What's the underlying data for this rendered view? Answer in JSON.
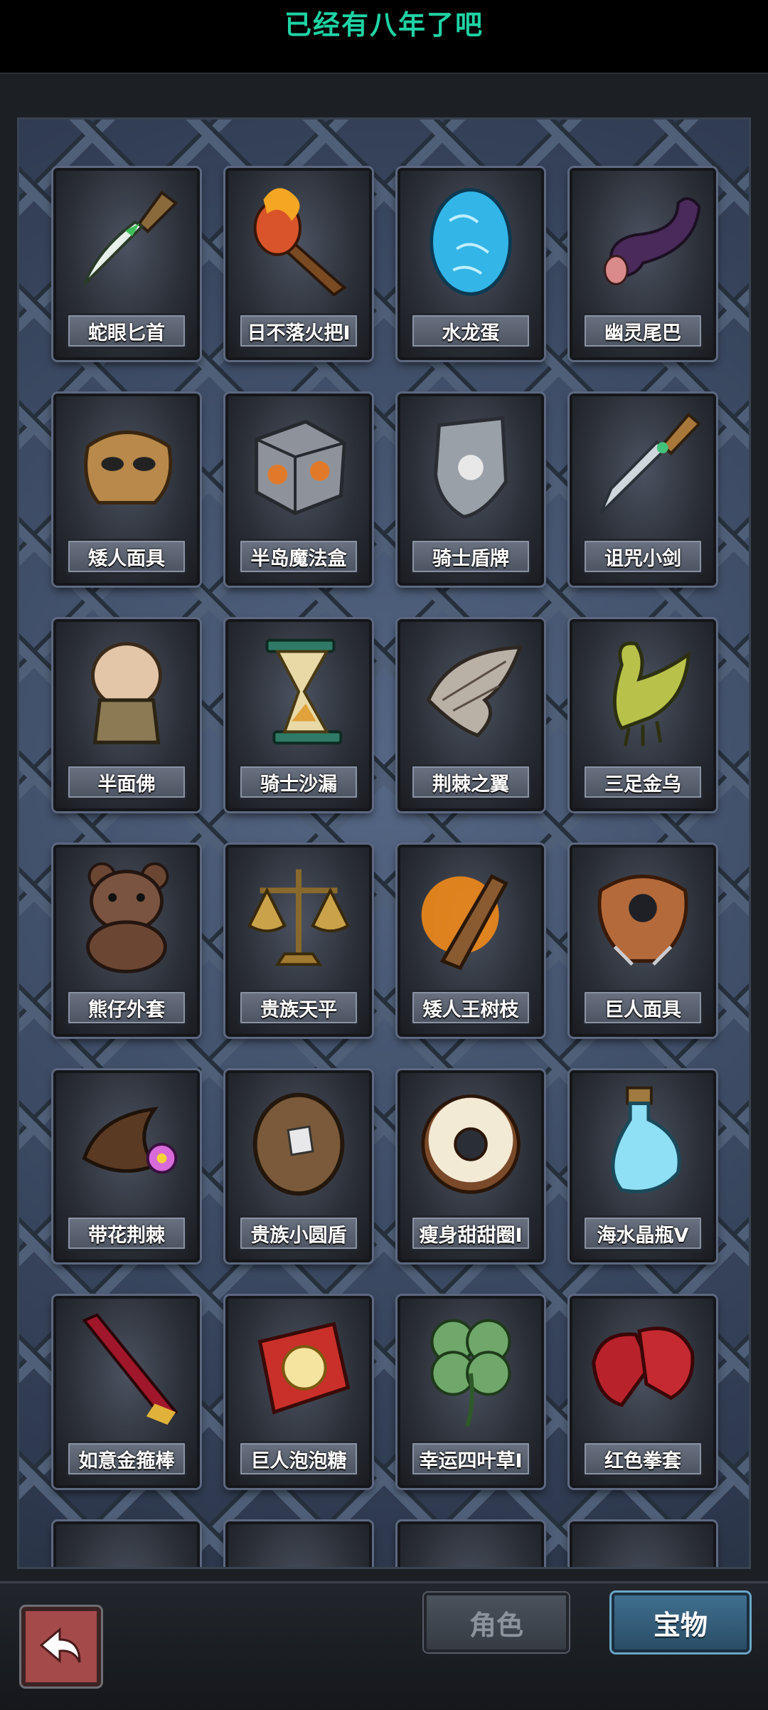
{
  "header": {
    "title": "已经有八年了吧"
  },
  "items": [
    {
      "label": "蛇眼匕首",
      "icon": "dagger-icon"
    },
    {
      "label": "日不落火把I",
      "icon": "torch-icon"
    },
    {
      "label": "水龙蛋",
      "icon": "egg-icon"
    },
    {
      "label": "幽灵尾巴",
      "icon": "ghost-tail-icon"
    },
    {
      "label": "矮人面具",
      "icon": "mask-icon"
    },
    {
      "label": "半岛魔法盒",
      "icon": "magic-box-icon"
    },
    {
      "label": "骑士盾牌",
      "icon": "shield-icon"
    },
    {
      "label": "诅咒小剑",
      "icon": "small-sword-icon"
    },
    {
      "label": "半面佛",
      "icon": "buddha-bust-icon"
    },
    {
      "label": "骑士沙漏",
      "icon": "hourglass-icon"
    },
    {
      "label": "荆棘之翼",
      "icon": "wing-icon"
    },
    {
      "label": "三足金乌",
      "icon": "golden-bird-icon"
    },
    {
      "label": "熊仔外套",
      "icon": "teddy-bear-icon"
    },
    {
      "label": "贵族天平",
      "icon": "scale-icon"
    },
    {
      "label": "矮人王树枝",
      "icon": "branch-icon"
    },
    {
      "label": "巨人面具",
      "icon": "giant-mask-icon"
    },
    {
      "label": "带花荆棘",
      "icon": "thorn-flower-icon"
    },
    {
      "label": "贵族小圆盾",
      "icon": "round-shield-icon"
    },
    {
      "label": "瘦身甜甜圈I",
      "icon": "donut-icon"
    },
    {
      "label": "海水晶瓶V",
      "icon": "potion-bottle-icon"
    },
    {
      "label": "如意金箍棒",
      "icon": "staff-icon"
    },
    {
      "label": "巨人泡泡糖",
      "icon": "gum-pack-icon"
    },
    {
      "label": "幸运四叶草I",
      "icon": "clover-icon"
    },
    {
      "label": "红色拳套",
      "icon": "boxing-glove-icon"
    }
  ],
  "bottom_bar": {
    "back_icon": "back-arrow-icon",
    "tabs": [
      {
        "label": "角色",
        "state": "inactive"
      },
      {
        "label": "宝物",
        "state": "active"
      }
    ]
  },
  "colors": {
    "title": "#1fd3a4",
    "board": "#3d4b60",
    "active_tab": "#3f6f8f",
    "back_button": "#a44a4a"
  }
}
